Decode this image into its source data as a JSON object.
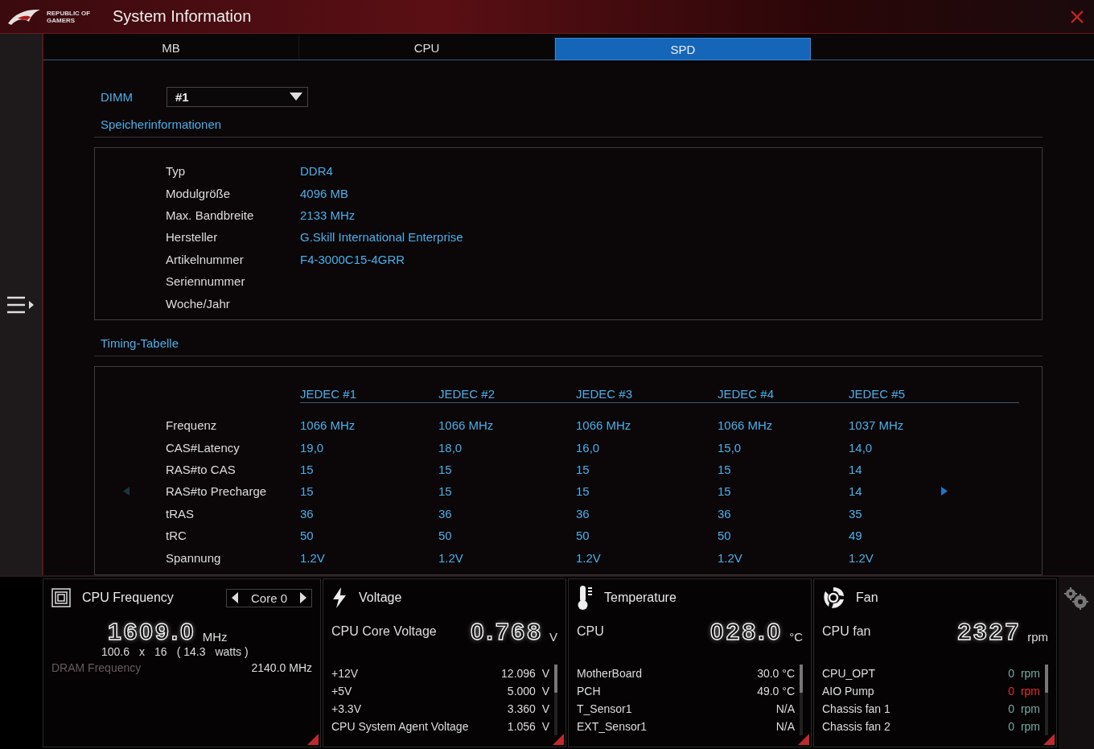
{
  "window": {
    "logo_text": "REPUBLIC OF GAMERS",
    "title": "System Information"
  },
  "tabs": [
    {
      "label": "MB",
      "selected": false
    },
    {
      "label": "CPU",
      "selected": false
    },
    {
      "label": "SPD",
      "selected": true
    }
  ],
  "dimm": {
    "label": "DIMM",
    "value": "#1"
  },
  "memory_info": {
    "title": "Speicherinformationen",
    "rows": [
      {
        "label": "Typ",
        "value": "DDR4"
      },
      {
        "label": "Modulgröße",
        "value": "4096 MB"
      },
      {
        "label": "Max. Bandbreite",
        "value": "2133 MHz"
      },
      {
        "label": "Hersteller",
        "value": "G.Skill International Enterprise"
      },
      {
        "label": "Artikelnummer",
        "value": "F4-3000C15-4GRR"
      },
      {
        "label": "Seriennummer",
        "value": ""
      },
      {
        "label": "Woche/Jahr",
        "value": ""
      }
    ]
  },
  "timing_table": {
    "title": "Timing-Tabelle",
    "prev_disabled": true,
    "next_disabled": false,
    "columns": [
      "JEDEC #1",
      "JEDEC #2",
      "JEDEC #3",
      "JEDEC #4",
      "JEDEC #5"
    ],
    "rows": [
      {
        "label": "Frequenz",
        "values": [
          "1066 MHz",
          "1066 MHz",
          "1066 MHz",
          "1066 MHz",
          "1037 MHz"
        ]
      },
      {
        "label": "CAS#Latency",
        "values": [
          "19,0",
          "18,0",
          "16,0",
          "15,0",
          "14,0"
        ]
      },
      {
        "label": "RAS#to CAS",
        "values": [
          "15",
          "15",
          "15",
          "15",
          "14"
        ]
      },
      {
        "label": "RAS#to Precharge",
        "values": [
          "15",
          "15",
          "15",
          "15",
          "14"
        ]
      },
      {
        "label": "tRAS",
        "values": [
          "36",
          "36",
          "36",
          "36",
          "35"
        ]
      },
      {
        "label": "tRC",
        "values": [
          "50",
          "50",
          "50",
          "50",
          "49"
        ]
      },
      {
        "label": "Spannung",
        "values": [
          "1.2V",
          "1.2V",
          "1.2V",
          "1.2V",
          "1.2V"
        ]
      }
    ]
  },
  "cpu_frequency": {
    "title": "CPU Frequency",
    "core": "Core 0",
    "value": "1609.0",
    "unit": "MHz",
    "detail": [
      "100.6",
      "x",
      "16",
      "( 14.3",
      "watts )"
    ],
    "dram_label": "DRAM Frequency",
    "dram_value": "2140.0  MHz"
  },
  "monitors": [
    {
      "kind": "voltage",
      "title": "Voltage",
      "main_label": "CPU Core Voltage",
      "main_value": "0.768",
      "main_unit": "V",
      "rows": [
        {
          "label": "+12V",
          "value": "12.096  V",
          "alert": false
        },
        {
          "label": "+5V",
          "value": "5.000  V",
          "alert": false
        },
        {
          "label": "+3.3V",
          "value": "3.360  V",
          "alert": false
        },
        {
          "label": "CPU System Agent Voltage",
          "value": "1.056  V",
          "alert": false
        }
      ]
    },
    {
      "kind": "temperature",
      "title": "Temperature",
      "main_label": "CPU",
      "main_value": "028.0",
      "main_unit": "°C",
      "rows": [
        {
          "label": "MotherBoard",
          "value": "30.0 °C",
          "alert": false
        },
        {
          "label": "PCH",
          "value": "49.0 °C",
          "alert": false
        },
        {
          "label": "T_Sensor1",
          "value": "N/A",
          "alert": false
        },
        {
          "label": "EXT_Sensor1",
          "value": "N/A",
          "alert": false
        }
      ]
    },
    {
      "kind": "fan",
      "title": "Fan",
      "main_label": "CPU fan",
      "main_value": "2327",
      "main_unit": "rpm",
      "rows": [
        {
          "label": "CPU_OPT",
          "value": "0  rpm",
          "alert": false
        },
        {
          "label": "AIO Pump",
          "value": "0  rpm",
          "alert": true
        },
        {
          "label": "Chassis fan 1",
          "value": "0  rpm",
          "alert": false
        },
        {
          "label": "Chassis fan 2",
          "value": "0  rpm",
          "alert": false
        }
      ]
    }
  ]
}
